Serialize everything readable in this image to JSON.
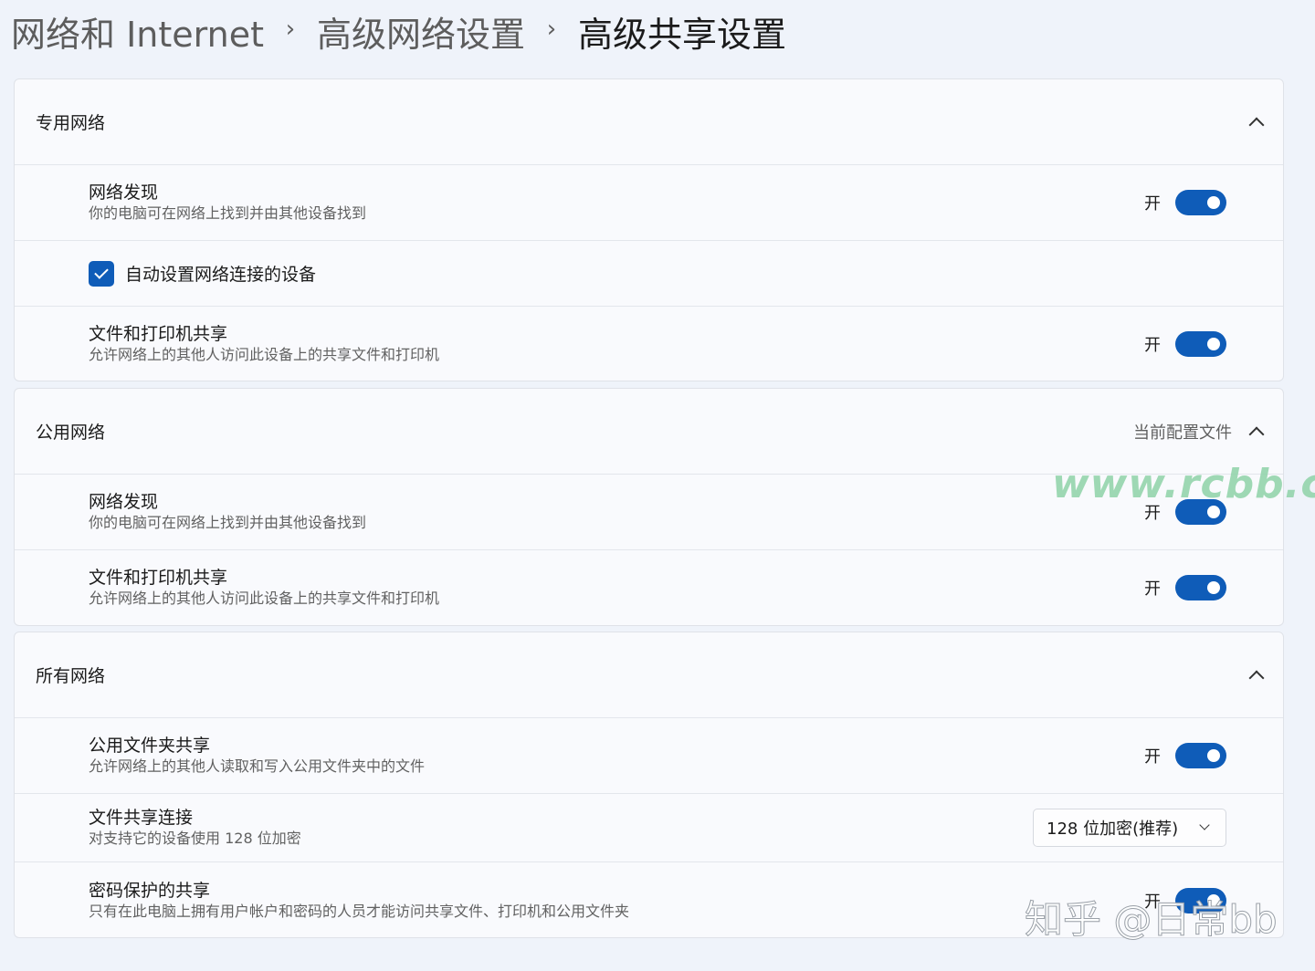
{
  "breadcrumb": {
    "items": [
      "网络和 Internet",
      "高级网络设置",
      "高级共享设置"
    ],
    "separator": "›"
  },
  "sections": {
    "private": {
      "title": "专用网络",
      "network_discovery": {
        "title": "网络发现",
        "desc": "你的电脑可在网络上找到并由其他设备找到",
        "state_label": "开"
      },
      "auto_setup": {
        "label": "自动设置网络连接的设备",
        "checked": true
      },
      "file_printer_sharing": {
        "title": "文件和打印机共享",
        "desc": "允许网络上的其他人访问此设备上的共享文件和打印机",
        "state_label": "开"
      }
    },
    "public": {
      "title": "公用网络",
      "status": "当前配置文件",
      "network_discovery": {
        "title": "网络发现",
        "desc": "你的电脑可在网络上找到并由其他设备找到",
        "state_label": "开"
      },
      "file_printer_sharing": {
        "title": "文件和打印机共享",
        "desc": "允许网络上的其他人访问此设备上的共享文件和打印机",
        "state_label": "开"
      }
    },
    "all": {
      "title": "所有网络",
      "public_folder_sharing": {
        "title": "公用文件夹共享",
        "desc": "允许网络上的其他人读取和写入公用文件夹中的文件",
        "state_label": "开"
      },
      "file_sharing_connections": {
        "title": "文件共享连接",
        "desc": "对支持它的设备使用 128 位加密",
        "dropdown_value": "128 位加密(推荐)"
      },
      "password_protected": {
        "title": "密码保护的共享",
        "desc": "只有在此电脑上拥有用户帐户和密码的人员才能访问共享文件、打印机和公用文件夹",
        "state_label": "开"
      }
    }
  },
  "watermarks": {
    "site": "www.rcbb.cc",
    "zhihu": "知乎 @日常bb"
  },
  "colors": {
    "accent": "#0f5cb8",
    "background": "#eff3fa",
    "card": "#f9fafd"
  }
}
